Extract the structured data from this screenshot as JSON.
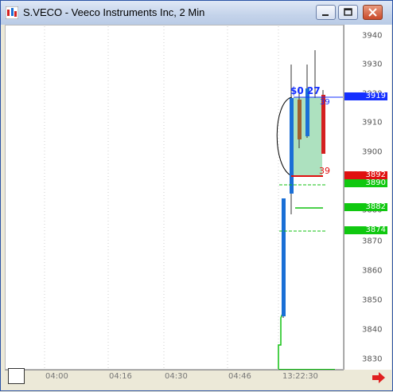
{
  "window": {
    "title": "S.VECO - Veeco Instruments Inc, 2 Min",
    "buttons": [
      "minimize",
      "restore",
      "close"
    ]
  },
  "chart": {
    "y_ticks": [
      "3940",
      "3930",
      "3920",
      "3910",
      "3900",
      "3890",
      "3880",
      "3870",
      "3860",
      "3850",
      "3840",
      "3830"
    ],
    "x_ticks": [
      "04:00",
      "04:16",
      "04:30",
      "04:46",
      "13:22:30"
    ],
    "price_tags": [
      {
        "label": "3919",
        "color": "#1530ff"
      },
      {
        "label": "3892",
        "color": "#e01010"
      },
      {
        "label": "3890",
        "color": "#10c810"
      },
      {
        "label": "3882",
        "color": "#10c810"
      },
      {
        "label": "3874",
        "color": "#10c810"
      }
    ],
    "annotations": {
      "top_label": "$0 27",
      "right_top": "39",
      "right_bottom": "39"
    },
    "colors": {
      "up_candle": "#1a6fd6",
      "down_candle": "#d42020",
      "neutral_candle": "#a06030",
      "green_line": "#10c010",
      "highlight": "#9fdcb4"
    }
  }
}
